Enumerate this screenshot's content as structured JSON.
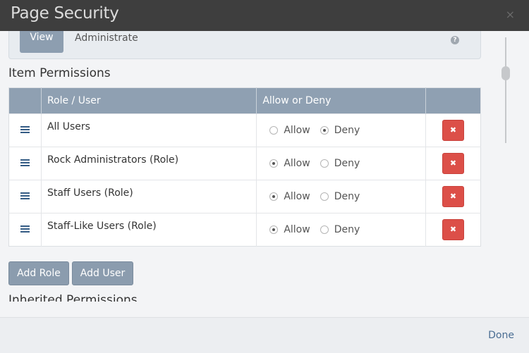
{
  "modal": {
    "title": "Page Security",
    "close_glyph": "×",
    "done_label": "Done"
  },
  "top_panel": {
    "action_label": "View",
    "role_text": "Administrate",
    "help_icon": "question-circle-icon"
  },
  "item_permissions": {
    "title": "Item Permissions",
    "headers": [
      "",
      "Role / User",
      "Allow or Deny",
      ""
    ],
    "allow_label": "Allow",
    "deny_label": "Deny",
    "rows": [
      {
        "name": "All Users",
        "value": "Deny"
      },
      {
        "name": "Rock Administrators (Role)",
        "value": "Allow"
      },
      {
        "name": "Staff Users (Role)",
        "value": "Allow"
      },
      {
        "name": "Staff-Like Users (Role)",
        "value": "Allow"
      }
    ],
    "delete_glyph": "✖"
  },
  "buttons": {
    "add_role": "Add Role",
    "add_user": "Add User"
  },
  "inherited_permissions": {
    "title": "Inherited Permissions"
  },
  "colors": {
    "header_bg": "#3e3e3e",
    "table_header_bg": "#8fa0b2",
    "delete_red": "#dc4f48",
    "link_blue": "#4a6d93"
  }
}
